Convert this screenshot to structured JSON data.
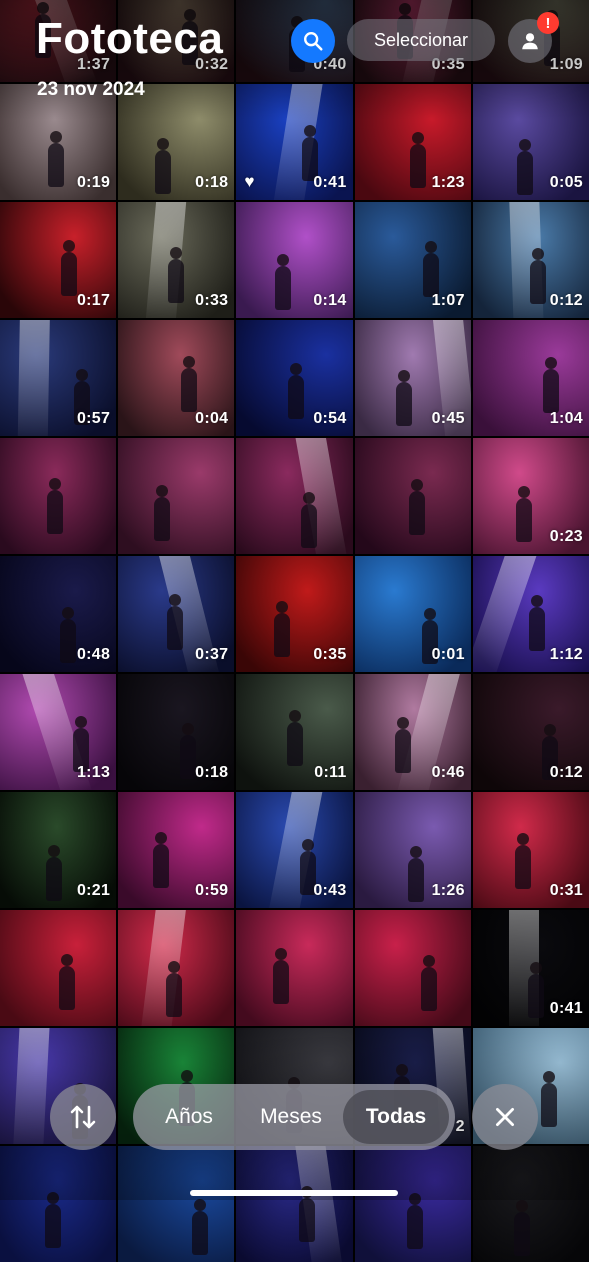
{
  "header": {
    "title": "Fototeca",
    "date": "23 nov 2024",
    "select_label": "Seleccionar",
    "alert_badge": "!"
  },
  "top_row": [
    {
      "duration": "1:37",
      "color": "#7a1e2a"
    },
    {
      "duration": "0:32",
      "color": "#6b5a4a"
    },
    {
      "duration": "0:40",
      "color": "#3a4e6a"
    },
    {
      "duration": "0:35",
      "color": "#8a2a4e"
    },
    {
      "duration": "1:09",
      "color": "#5a5a4a"
    }
  ],
  "rows": [
    [
      {
        "duration": "0:19",
        "color": "#9a8a8e",
        "color2": "#3a2e2e"
      },
      {
        "duration": "0:18",
        "color": "#8e8c6a",
        "color2": "#2e2c1e"
      },
      {
        "duration": "0:41",
        "color": "#1a40c0",
        "color2": "#0a1450",
        "favorite": true
      },
      {
        "duration": "1:23",
        "color": "#c81a2a",
        "color2": "#4a0810"
      },
      {
        "duration": "0:05",
        "color": "#5a4aa0",
        "color2": "#1a1440"
      }
    ],
    [
      {
        "duration": "0:17",
        "color": "#c8202a",
        "color2": "#2a0608"
      },
      {
        "duration": "0:33",
        "color": "#6a6a5a",
        "color2": "#1e1e18"
      },
      {
        "duration": "0:14",
        "color": "#b050c8",
        "color2": "#3a1a50"
      },
      {
        "duration": "1:07",
        "color": "#2a5a9a",
        "color2": "#0a1a30"
      },
      {
        "duration": "0:12",
        "color": "#4a7aa8",
        "color2": "#14243a"
      }
    ],
    [
      {
        "duration": "0:57",
        "color": "#2a3a7a",
        "color2": "#0a0e2a"
      },
      {
        "duration": "0:04",
        "color": "#a04a5a",
        "color2": "#2a1418"
      },
      {
        "duration": "0:54",
        "color": "#1a30a0",
        "color2": "#060a30"
      },
      {
        "duration": "0:45",
        "color": "#a07ab0",
        "color2": "#3a2a44"
      },
      {
        "duration": "1:04",
        "color": "#9a3a9a",
        "color2": "#3a103a"
      }
    ],
    [
      {
        "duration": "",
        "color": "#8a2a5a",
        "color2": "#2a0a1e"
      },
      {
        "duration": "",
        "color": "#9a3a6a",
        "color2": "#2e0e20"
      },
      {
        "duration": "",
        "color": "#8a2a5e",
        "color2": "#2a0a1c"
      },
      {
        "duration": "",
        "color": "#7a2a50",
        "color2": "#24081a"
      },
      {
        "duration": "0:23",
        "color": "#d04a8a",
        "color2": "#4a1430"
      }
    ],
    [
      {
        "duration": "0:48",
        "color": "#1a1a4a",
        "color2": "#06061a"
      },
      {
        "duration": "0:37",
        "color": "#2a3a8a",
        "color2": "#0a0e2a"
      },
      {
        "duration": "0:35",
        "color": "#c01a1a",
        "color2": "#3a0606"
      },
      {
        "duration": "0:01",
        "color": "#2a7ad0",
        "color2": "#0a2a5a"
      },
      {
        "duration": "1:12",
        "color": "#5a3ac0",
        "color2": "#1a1050"
      }
    ],
    [
      {
        "duration": "1:13",
        "color": "#b04ab0",
        "color2": "#3a1040"
      },
      {
        "duration": "0:18",
        "color": "#1a1620",
        "color2": "#060508"
      },
      {
        "duration": "0:11",
        "color": "#4a5a4a",
        "color2": "#0e120e"
      },
      {
        "duration": "0:46",
        "color": "#b07aa0",
        "color2": "#3a2030"
      },
      {
        "duration": "0:12",
        "color": "#3a1a2a",
        "color2": "#0e0608"
      }
    ],
    [
      {
        "duration": "0:21",
        "color": "#2a4a2a",
        "color2": "#060c06"
      },
      {
        "duration": "0:59",
        "color": "#c02a8a",
        "color2": "#3a0a2a"
      },
      {
        "duration": "0:43",
        "color": "#2a4ab0",
        "color2": "#0a1440"
      },
      {
        "duration": "1:26",
        "color": "#7a5ab0",
        "color2": "#2a1a40"
      },
      {
        "duration": "0:31",
        "color": "#d02a4a",
        "color2": "#4a0a14"
      }
    ],
    [
      {
        "duration": "",
        "color": "#c8203a",
        "color2": "#4a0a14"
      },
      {
        "duration": "",
        "color": "#d02a4a",
        "color2": "#4a0a18"
      },
      {
        "duration": "",
        "color": "#c82a5a",
        "color2": "#440a1e"
      },
      {
        "duration": "",
        "color": "#c8204a",
        "color2": "#440a18"
      },
      {
        "duration": "0:41",
        "color": "#0a0a0e",
        "color2": "#020203"
      }
    ],
    [
      {
        "duration": "",
        "color": "#4a3ab0",
        "color2": "#1a1440"
      },
      {
        "duration": "",
        "color": "#1a8a3a",
        "color2": "#06240e"
      },
      {
        "duration": "",
        "color": "#3a3a40",
        "color2": "#101014"
      },
      {
        "duration": "2",
        "color": "#1a1e4a",
        "color2": "#080a1a"
      },
      {
        "duration": "",
        "color": "#9ac0d8",
        "color2": "#3a5a70"
      }
    ],
    [
      {
        "duration": "",
        "color": "#1a2a8a",
        "color2": "#0a1040"
      },
      {
        "duration": "",
        "color": "#1a4aa0",
        "color2": "#0a1a40"
      },
      {
        "duration": "",
        "color": "#2a2a8a",
        "color2": "#0a0a30"
      },
      {
        "duration": "",
        "color": "#3a2aa0",
        "color2": "#10103a"
      },
      {
        "duration": "",
        "color": "#1a1a1e",
        "color2": "#060608"
      }
    ]
  ],
  "toolbar": {
    "segments": [
      "Años",
      "Meses",
      "Todas"
    ],
    "selected": "Todas"
  },
  "icons": {
    "search": "search-icon",
    "profile": "person-icon",
    "sort": "sort-arrows-icon",
    "close": "close-icon",
    "favorite": "heart-icon"
  },
  "colors": {
    "accent": "#1479ff",
    "badge": "#ff3b30"
  }
}
